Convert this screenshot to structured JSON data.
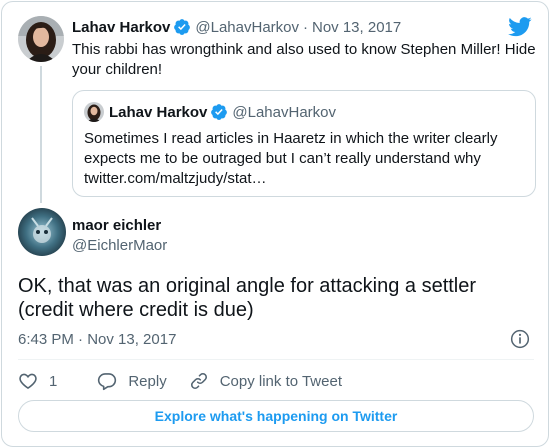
{
  "colors": {
    "accent": "#1d9bf0",
    "text": "#0f1419",
    "muted": "#536471",
    "border": "#cfd9de"
  },
  "parent_tweet": {
    "name": "Lahav Harkov",
    "verified": true,
    "handle": "@LahavHarkov",
    "separator": "·",
    "date": "Nov 13, 2017",
    "text": "This rabbi has wrongthink and also used to know Stephen Miller! Hide your children!"
  },
  "quoted_tweet": {
    "name": "Lahav Harkov",
    "verified": true,
    "handle": "@LahavHarkov",
    "text_lines": [
      "Sometimes I read articles in Haaretz in which the writer clearly",
      "expects me to be outraged but I can’t really understand why",
      "twitter.com/maltzjudy/stat…"
    ]
  },
  "main_tweet": {
    "name": "maor eichler",
    "handle": "@EichlerMaor",
    "text_lines": [
      "OK, that was an original angle for attacking a settler",
      "(credit where credit is due)"
    ],
    "timestamp": "6:43 PM · Nov 13, 2017"
  },
  "actions": {
    "like_count": "1",
    "reply_label": "Reply",
    "copy_link_label": "Copy link to Tweet"
  },
  "explore_label": "Explore what's happening on Twitter",
  "icons": [
    "twitter-bird-icon",
    "verified-badge-icon",
    "info-icon",
    "heart-icon",
    "reply-icon",
    "link-icon"
  ]
}
